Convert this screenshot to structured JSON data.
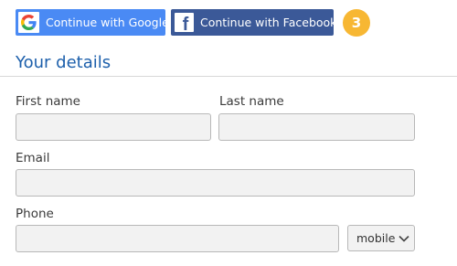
{
  "social": {
    "google_label": "Continue with Google",
    "facebook_label": "Continue with Facebook",
    "step_number": "3"
  },
  "section": {
    "title": "Your details"
  },
  "form": {
    "first_name_label": "First name",
    "last_name_label": "Last name",
    "email_label": "Email",
    "phone_label": "Phone",
    "first_name_value": "",
    "last_name_value": "",
    "email_value": "",
    "phone_value": "",
    "phone_type_selected": "mobile"
  },
  "colors": {
    "google_blue": "#4a8af4",
    "facebook_blue": "#3b5998",
    "badge_orange": "#f7b733",
    "title_blue": "#1c5fab"
  },
  "icons": {
    "google": "google-icon",
    "facebook": "facebook-icon",
    "select_arrow": "chevron-down-icon"
  }
}
